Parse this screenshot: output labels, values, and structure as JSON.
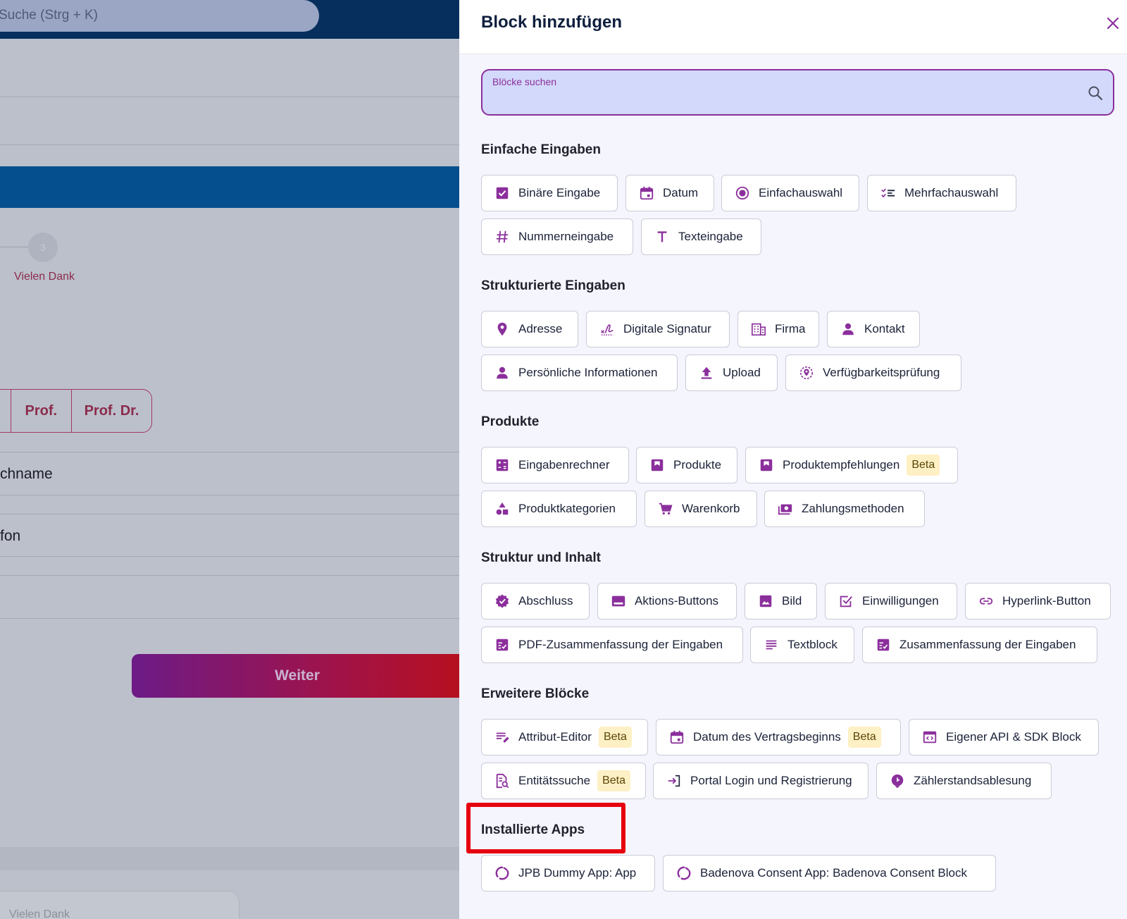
{
  "background": {
    "search_placeholder": "Suche (Strg + K)",
    "step_number": "3",
    "step_label": "Vielen Dank",
    "salutation_options": [
      "Prof.",
      "Prof. Dr."
    ],
    "field_lastname": "chname",
    "field_phone": "fon",
    "next_button": "Weiter",
    "footer_step": "Vielen Dank"
  },
  "panel": {
    "title": "Block hinzufügen",
    "search_label": "Blöcke suchen",
    "beta_label": "Beta",
    "sections": [
      {
        "title": "Einfache Eingaben",
        "items": [
          {
            "label": "Binäre Eingabe",
            "icon": "checkbox-icon"
          },
          {
            "label": "Datum",
            "icon": "calendar-icon"
          },
          {
            "label": "Einfachauswahl",
            "icon": "radio-icon"
          },
          {
            "label": "Mehrfachauswahl",
            "icon": "checklist-icon"
          },
          {
            "label": "Nummerneingabe",
            "icon": "hash-icon"
          },
          {
            "label": "Texteingabe",
            "icon": "text-t-icon"
          }
        ]
      },
      {
        "title": "Strukturierte Eingaben",
        "items": [
          {
            "label": "Adresse",
            "icon": "location-pin-icon"
          },
          {
            "label": "Digitale Signatur",
            "icon": "signature-icon"
          },
          {
            "label": "Firma",
            "icon": "building-icon"
          },
          {
            "label": "Kontakt",
            "icon": "person-icon"
          },
          {
            "label": "Persönliche Informationen",
            "icon": "person-icon"
          },
          {
            "label": "Upload",
            "icon": "upload-icon"
          },
          {
            "label": "Verfügbarkeitsprüfung",
            "icon": "location-target-icon"
          }
        ]
      },
      {
        "title": "Produkte",
        "items": [
          {
            "label": "Eingabenrechner",
            "icon": "calculator-icon"
          },
          {
            "label": "Produkte",
            "icon": "product-box-icon"
          },
          {
            "label": "Produktempfehlungen",
            "icon": "product-box-icon",
            "beta": true
          },
          {
            "label": "Produktkategorien",
            "icon": "shapes-icon"
          },
          {
            "label": "Warenkorb",
            "icon": "cart-icon"
          },
          {
            "label": "Zahlungsmethoden",
            "icon": "money-icon"
          }
        ]
      },
      {
        "title": "Struktur und Inhalt",
        "items": [
          {
            "label": "Abschluss",
            "icon": "verified-badge-icon"
          },
          {
            "label": "Aktions-Buttons",
            "icon": "button-bar-icon"
          },
          {
            "label": "Bild",
            "icon": "image-icon"
          },
          {
            "label": "Einwilligungen",
            "icon": "checkbox-outline-icon"
          },
          {
            "label": "Hyperlink-Button",
            "icon": "link-icon"
          },
          {
            "label": "PDF-Zusammenfassung der Eingaben",
            "icon": "summary-list-icon"
          },
          {
            "label": "Textblock",
            "icon": "text-lines-icon"
          },
          {
            "label": "Zusammenfassung der Eingaben",
            "icon": "summary-list-icon"
          }
        ]
      },
      {
        "title": "Erweitere Blöcke",
        "items": [
          {
            "label": "Attribut-Editor",
            "icon": "edit-lines-icon",
            "beta": true
          },
          {
            "label": "Datum des Vertragsbeginns",
            "icon": "calendar-icon",
            "beta": true
          },
          {
            "label": "Eigener API & SDK Block",
            "icon": "code-window-icon"
          },
          {
            "label": "Entitätssuche",
            "icon": "document-search-icon",
            "beta": true
          },
          {
            "label": "Portal Login und Registrierung",
            "icon": "login-icon"
          },
          {
            "label": "Zählerstandsablesung",
            "icon": "meter-icon"
          }
        ]
      },
      {
        "title": "Installierte Apps",
        "items": [
          {
            "label": "JPB Dummy App: App",
            "icon": "app-logo-icon"
          },
          {
            "label": "Badenova Consent App: Badenova Consent Block",
            "icon": "app-logo-icon"
          }
        ]
      }
    ]
  },
  "colors": {
    "accent": "#8b2f9c",
    "highlight": "#e6000f",
    "title": "#0e1f3d",
    "beta_bg": "#fdf0c4"
  }
}
